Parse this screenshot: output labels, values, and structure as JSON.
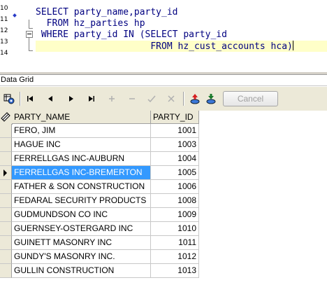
{
  "editor": {
    "line_numbers": [
      "10",
      "11",
      "12",
      "13",
      "14"
    ],
    "lines": [
      "",
      "SELECT party_name,party_id",
      "  FROM hz_parties hp",
      " WHERE party_id IN (SELECT party_id",
      "                     FROM hz_cust_accounts hca)"
    ],
    "current_line_color": "#ffffc8",
    "keyword_color": "#0000a0"
  },
  "panel": {
    "title": "Data Grid"
  },
  "toolbar": {
    "icons": [
      "grid-settings-icon",
      "first-record-icon",
      "prior-record-icon",
      "next-record-icon",
      "last-record-icon",
      "insert-record-icon",
      "delete-record-icon",
      "post-edit-icon",
      "cancel-edit-icon",
      "export-icon",
      "import-icon"
    ],
    "cancel_label": "Cancel"
  },
  "grid": {
    "columns": [
      "PARTY_NAME",
      "PARTY_ID"
    ],
    "selected_row": 3,
    "selection_color": "#3399ff",
    "rows": [
      {
        "party_name": "FERO, JIM",
        "party_id": "1001"
      },
      {
        "party_name": "HAGUE INC",
        "party_id": "1003"
      },
      {
        "party_name": "FERRELLGAS INC-AUBURN",
        "party_id": "1004"
      },
      {
        "party_name": "FERRELLGAS INC-BREMERTON",
        "party_id": "1005"
      },
      {
        "party_name": "FATHER & SON CONSTRUCTION",
        "party_id": "1006"
      },
      {
        "party_name": "FEDARAL SECURITY PRODUCTS",
        "party_id": "1008"
      },
      {
        "party_name": "GUDMUNDSON CO INC",
        "party_id": "1009"
      },
      {
        "party_name": "GUERNSEY-OSTERGARD INC",
        "party_id": "1010"
      },
      {
        "party_name": "GUINETT MASONRY INC",
        "party_id": "1011"
      },
      {
        "party_name": "GUNDY'S MASONRY INC.",
        "party_id": "1012"
      },
      {
        "party_name": "GULLIN CONSTRUCTION",
        "party_id": "1013"
      }
    ]
  }
}
